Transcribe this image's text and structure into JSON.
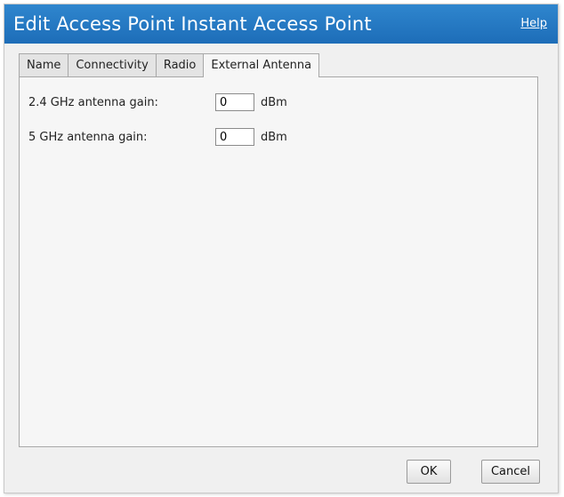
{
  "dialog": {
    "title": "Edit Access Point Instant Access Point",
    "help_label": "Help"
  },
  "tabs": [
    {
      "label": "Name"
    },
    {
      "label": "Connectivity"
    },
    {
      "label": "Radio"
    },
    {
      "label": "External Antenna",
      "active": true
    }
  ],
  "fields": {
    "gain_24": {
      "label": "2.4 GHz antenna gain:",
      "value": "0",
      "unit": "dBm"
    },
    "gain_5": {
      "label": "5 GHz antenna gain:",
      "value": "0",
      "unit": "dBm"
    }
  },
  "buttons": {
    "ok_label": "OK",
    "cancel_label": "Cancel"
  },
  "colors": {
    "titlebar": "#1d6db8",
    "dialog_bg": "#f0f0f0"
  }
}
